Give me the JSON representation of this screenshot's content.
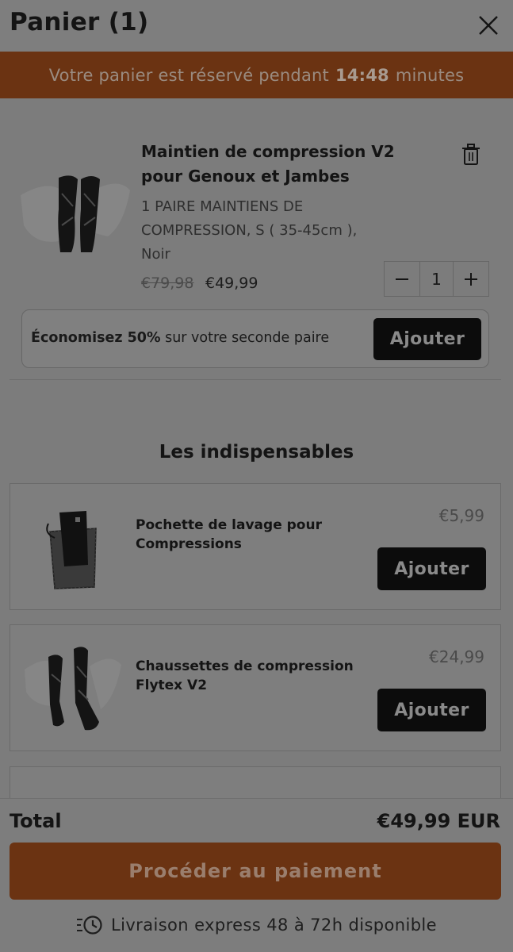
{
  "header": {
    "title": "Panier (1)",
    "close_icon": "close-icon"
  },
  "banner": {
    "prefix": "Votre panier est réservé pendant",
    "time": "14:48",
    "suffix": "minutes"
  },
  "cart_item": {
    "title": "Maintien de compression V2 pour Genoux et Jambes",
    "variant": "1 PAIRE MAINTIENS DE COMPRESSION, S ( 35-45cm ), Noir",
    "old_price": "€79,98",
    "price": "€49,99",
    "quantity": "1",
    "trash_icon": "trash-icon"
  },
  "upsell": {
    "bold": "Économisez 50%",
    "rest": "sur votre seconde paire",
    "button": "Ajouter"
  },
  "recommendations": {
    "title": "Les indispensables",
    "items": [
      {
        "title": "Pochette de lavage pour Compressions",
        "price": "€5,99",
        "button": "Ajouter"
      },
      {
        "title": "Chaussettes de compression Flytex V2",
        "price": "€24,99",
        "button": "Ajouter"
      }
    ]
  },
  "footer": {
    "total_label": "Total",
    "total_value": "€49,99 EUR",
    "checkout": "Procéder au paiement",
    "delivery": "Livraison express 48 à 72h disponible",
    "delivery_icon": "clock-fast-icon"
  },
  "colors": {
    "accent": "#6b3312",
    "button_dark": "#0c0c0c",
    "overlay_bg": "#7c7c7c"
  }
}
